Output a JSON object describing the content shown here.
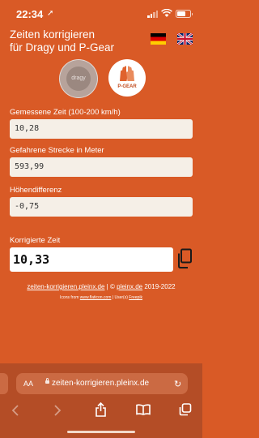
{
  "status_bar": {
    "time": "22:34",
    "location_glyph": "➚"
  },
  "header": {
    "title_line1": "Zeiten korrigieren",
    "title_line2": "für Dragy und P-Gear",
    "languages": [
      "de-flag-icon",
      "uk-flag-icon"
    ]
  },
  "devices": {
    "dragy_label": "dragy",
    "pgear_label": "P-GEAR"
  },
  "fields": {
    "measured_time_label": "Gemessene Zeit (100-200 km/h)",
    "measured_time_value": "10,28",
    "distance_label": "Gefahrene Strecke in Meter",
    "distance_value": "593,99",
    "height_label": "Höhendifferenz",
    "height_value": "-0,75"
  },
  "result": {
    "label": "Korrigierte Zeit",
    "value": "10,33"
  },
  "footer": {
    "site_link": "zeiten-korrigieren.pleinx.de",
    "separator": " | © ",
    "owner_link": "pleinx.de",
    "years": " 2019-2022",
    "icons_prefix": "Icons from ",
    "icons_link": "www.flaticon.com",
    "icons_mid": " | User(s) ",
    "icons_user": "Freepik"
  },
  "browser": {
    "aa_label": "AA",
    "url": "zeiten-korrigieren.pleinx.de",
    "reload_glyph": "↻"
  },
  "colors": {
    "background": "#d95a26",
    "browser_bar": "#b44d26",
    "field": "#f5efe7"
  }
}
